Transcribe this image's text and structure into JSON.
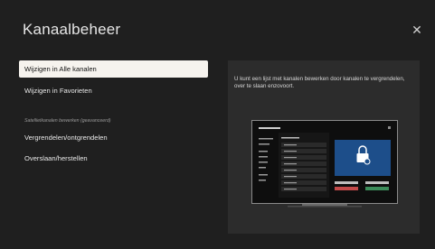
{
  "header": {
    "title": "Kanaalbeheer",
    "close_icon": "close-icon"
  },
  "menu": {
    "items": [
      {
        "label": "Wijzigen in Alle kanalen",
        "selected": true
      },
      {
        "label": "Wijzigen in Favorieten",
        "selected": false
      }
    ],
    "section_label": "Satellietkanalen bewerken (geavanceerd)",
    "advanced_items": [
      {
        "label": "Vergrendelen/ontgrendelen"
      },
      {
        "label": "Overslaan/herstellen"
      }
    ]
  },
  "info_panel": {
    "description": "U kunt een lijst met kanalen bewerken door kanalen te vergrendelen, over te slaan enzovoort.",
    "illustration_icon": "lock-icon"
  },
  "colors": {
    "background": "#1f1f1f",
    "selected_item": "#f6f3ee",
    "panel": "#2c2c2c",
    "accent": "#1d4e8a"
  }
}
